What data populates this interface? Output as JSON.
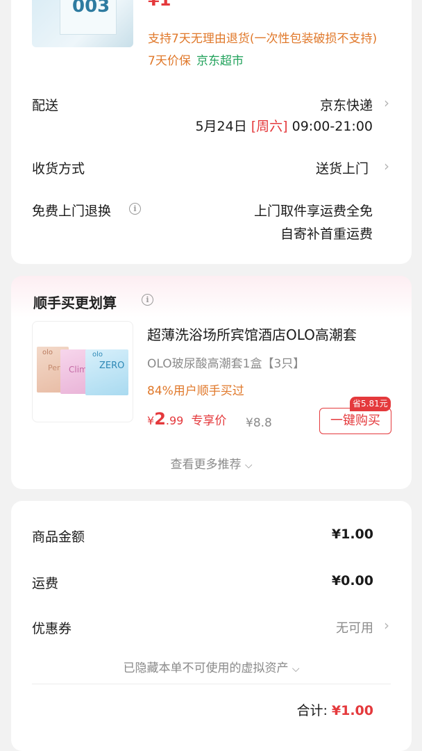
{
  "top_product": {
    "image_text": "003",
    "price_partial": "¥1",
    "return_policy": "支持7天无理由退货(一次性包装破损不支持)",
    "price_protect": "7天价保",
    "store_tag": "京东超市"
  },
  "delivery": {
    "label": "配送",
    "method": "京东快递",
    "date": "5月24日",
    "weekday": "[周六]",
    "time": "09:00-21:00"
  },
  "receive": {
    "label": "收货方式",
    "value": "送货上门"
  },
  "free_return": {
    "label": "免费上门退换",
    "line1": "上门取件享运费全免",
    "line2": "自寄补首重运费"
  },
  "bundle": {
    "title": "顺手买更划算",
    "product_title": "超薄洗浴场所宾馆酒店OLO高潮套",
    "product_subtitle": "OLO玻尿酸高潮套1盒【3只】",
    "buyers_rate": "84%用户顺手买过",
    "price_symbol": "¥",
    "price_int": "2",
    "price_dec": ".99",
    "price_tag": "专享价",
    "orig_price": "¥8.8",
    "save_badge": "省5.81元",
    "buy_button": "一键购买",
    "more": "查看更多推荐",
    "image_labels": [
      "olo",
      "olo",
      "Perf",
      "Clim",
      "ZERO"
    ]
  },
  "summary": {
    "goods_label": "商品金额",
    "goods_value": "¥1.00",
    "shipping_label": "运费",
    "shipping_value": "¥0.00",
    "coupon_label": "优惠券",
    "coupon_value": "无可用",
    "hidden_assets": "已隐藏本单不可使用的虚拟资产",
    "total_label": "合计:",
    "total_value": "¥1.00"
  },
  "colors": {
    "accent_red": "#e4393c",
    "orange": "#e0782a",
    "green": "#21a25b"
  }
}
